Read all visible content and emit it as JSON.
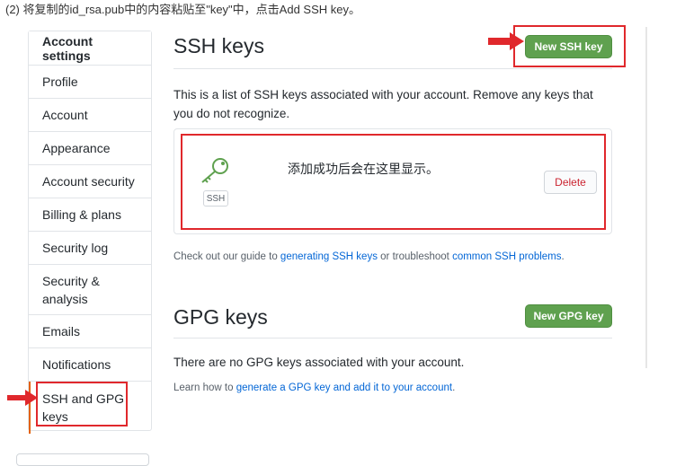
{
  "caption": "(2) 将复制的id_rsa.pub中的内容粘贴至\"key\"中，点击Add SSH key。",
  "sidebar": {
    "header": "Account settings",
    "items": [
      {
        "label": "Profile"
      },
      {
        "label": "Account"
      },
      {
        "label": "Appearance"
      },
      {
        "label": "Account security"
      },
      {
        "label": "Billing & plans"
      },
      {
        "label": "Security log"
      },
      {
        "label": "Security & analysis"
      },
      {
        "label": "Emails"
      },
      {
        "label": "Notifications"
      },
      {
        "label": "SSH and GPG keys"
      }
    ],
    "active_item": "SSH and GPG keys"
  },
  "ssh": {
    "title": "SSH keys",
    "new_button": "New SSH key",
    "description": "This is a list of SSH keys associated with your account. Remove any keys that you do not recognize.",
    "badge": "SSH",
    "added_message": "添加成功后会在这里显示。",
    "delete_label": "Delete",
    "guide_prefix": "Check out our guide to ",
    "guide_link1": "generating SSH keys",
    "guide_mid": " or troubleshoot ",
    "guide_link2": "common SSH problems",
    "guide_suffix": "."
  },
  "gpg": {
    "title": "GPG keys",
    "new_button": "New GPG key",
    "empty_text": "There are no GPG keys associated with your account.",
    "learn_prefix": "Learn how to ",
    "learn_link": "generate a GPG key and add it to your account",
    "learn_suffix": "."
  },
  "colors": {
    "accent_green": "#5fa14f",
    "annotation_red": "#e0282c",
    "link_blue": "#0366d6",
    "active_marker": "#e36209"
  },
  "icons": [
    "key-icon",
    "arrow-icon"
  ]
}
